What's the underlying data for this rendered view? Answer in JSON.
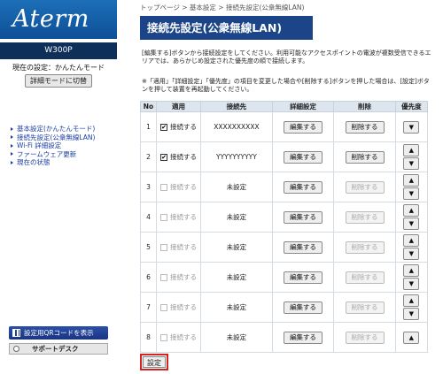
{
  "sidebar": {
    "logo": "Aterm",
    "model": "W300P",
    "current_setting": "現在の設定：かんたんモード",
    "mode_button": "詳細モードに切替",
    "nav": [
      "基本設定(かんたんモード)",
      "接続先設定(公衆無線LAN)",
      "Wi-Fi 詳細設定",
      "ファームウェア更新",
      "現在の状態"
    ],
    "qr_button": "設定用QRコードを表示",
    "support_button": "サポートデスク"
  },
  "main": {
    "breadcrumb": "トップページ > 基本設定 > 接続先設定(公衆無線LAN)",
    "title": "接続先設定(公衆無線LAN)",
    "description": "[編集する]ボタンから接続設定をしてください。利用可能なアクセスポイントの電波が複数受信できるエリアでは、あらかじめ設定された優先度の順で接続します。",
    "note": "※「適用」「詳細設定」「優先度」の項目を変更した場合や[削除する]ボタンを押した場合は、[設定]ボタンを押して装置を再起動してください。",
    "columns": [
      "No",
      "適用",
      "接続先",
      "詳細設定",
      "削除",
      "優先度"
    ],
    "rows": [
      {
        "no": "1",
        "apply": "接続する",
        "checked": true,
        "dest": "XXXXXXXXXX",
        "edit": "編集する",
        "del": "削除する",
        "active": true
      },
      {
        "no": "2",
        "apply": "接続する",
        "checked": true,
        "dest": "YYYYYYYYYY",
        "edit": "編集する",
        "del": "削除する",
        "active": true
      },
      {
        "no": "3",
        "apply": "接続する",
        "checked": false,
        "dest": "未設定",
        "edit": "編集する",
        "del": "削除する",
        "active": false
      },
      {
        "no": "4",
        "apply": "接続する",
        "checked": false,
        "dest": "未設定",
        "edit": "編集する",
        "del": "削除する",
        "active": false
      },
      {
        "no": "5",
        "apply": "接続する",
        "checked": false,
        "dest": "未設定",
        "edit": "編集する",
        "del": "削除する",
        "active": false
      },
      {
        "no": "6",
        "apply": "接続する",
        "checked": false,
        "dest": "未設定",
        "edit": "編集する",
        "del": "削除する",
        "active": false
      },
      {
        "no": "7",
        "apply": "接続する",
        "checked": false,
        "dest": "未設定",
        "edit": "編集する",
        "del": "削除する",
        "active": false
      },
      {
        "no": "8",
        "apply": "接続する",
        "checked": false,
        "dest": "未設定",
        "edit": "編集する",
        "del": "削除する",
        "active": false
      }
    ],
    "up_symbol": "▲",
    "down_symbol": "▼",
    "set_button": "設定"
  }
}
